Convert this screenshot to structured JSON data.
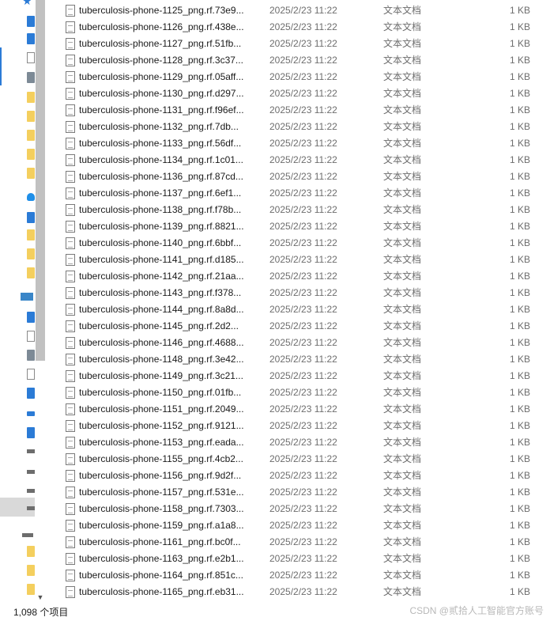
{
  "navigation": {
    "star_glyph": "★",
    "scroll_down_glyph": "▼"
  },
  "files": [
    {
      "name": "tuberculosis-phone-1125_png.rf.73e9...",
      "date": "2025/2/23 11:22",
      "type": "文本文档",
      "size": "1 KB"
    },
    {
      "name": "tuberculosis-phone-1126_png.rf.438e...",
      "date": "2025/2/23 11:22",
      "type": "文本文档",
      "size": "1 KB"
    },
    {
      "name": "tuberculosis-phone-1127_png.rf.51fb...",
      "date": "2025/2/23 11:22",
      "type": "文本文档",
      "size": "1 KB"
    },
    {
      "name": "tuberculosis-phone-1128_png.rf.3c37...",
      "date": "2025/2/23 11:22",
      "type": "文本文档",
      "size": "1 KB"
    },
    {
      "name": "tuberculosis-phone-1129_png.rf.05aff...",
      "date": "2025/2/23 11:22",
      "type": "文本文档",
      "size": "1 KB"
    },
    {
      "name": "tuberculosis-phone-1130_png.rf.d297...",
      "date": "2025/2/23 11:22",
      "type": "文本文档",
      "size": "1 KB"
    },
    {
      "name": "tuberculosis-phone-1131_png.rf.f96ef...",
      "date": "2025/2/23 11:22",
      "type": "文本文档",
      "size": "1 KB"
    },
    {
      "name": "tuberculosis-phone-1132_png.rf.7db...",
      "date": "2025/2/23 11:22",
      "type": "文本文档",
      "size": "1 KB"
    },
    {
      "name": "tuberculosis-phone-1133_png.rf.56df...",
      "date": "2025/2/23 11:22",
      "type": "文本文档",
      "size": "1 KB"
    },
    {
      "name": "tuberculosis-phone-1134_png.rf.1c01...",
      "date": "2025/2/23 11:22",
      "type": "文本文档",
      "size": "1 KB"
    },
    {
      "name": "tuberculosis-phone-1136_png.rf.87cd...",
      "date": "2025/2/23 11:22",
      "type": "文本文档",
      "size": "1 KB"
    },
    {
      "name": "tuberculosis-phone-1137_png.rf.6ef1...",
      "date": "2025/2/23 11:22",
      "type": "文本文档",
      "size": "1 KB"
    },
    {
      "name": "tuberculosis-phone-1138_png.rf.f78b...",
      "date": "2025/2/23 11:22",
      "type": "文本文档",
      "size": "1 KB"
    },
    {
      "name": "tuberculosis-phone-1139_png.rf.8821...",
      "date": "2025/2/23 11:22",
      "type": "文本文档",
      "size": "1 KB"
    },
    {
      "name": "tuberculosis-phone-1140_png.rf.6bbf...",
      "date": "2025/2/23 11:22",
      "type": "文本文档",
      "size": "1 KB"
    },
    {
      "name": "tuberculosis-phone-1141_png.rf.d185...",
      "date": "2025/2/23 11:22",
      "type": "文本文档",
      "size": "1 KB"
    },
    {
      "name": "tuberculosis-phone-1142_png.rf.21aa...",
      "date": "2025/2/23 11:22",
      "type": "文本文档",
      "size": "1 KB"
    },
    {
      "name": "tuberculosis-phone-1143_png.rf.f378...",
      "date": "2025/2/23 11:22",
      "type": "文本文档",
      "size": "1 KB"
    },
    {
      "name": "tuberculosis-phone-1144_png.rf.8a8d...",
      "date": "2025/2/23 11:22",
      "type": "文本文档",
      "size": "1 KB"
    },
    {
      "name": "tuberculosis-phone-1145_png.rf.2d2...",
      "date": "2025/2/23 11:22",
      "type": "文本文档",
      "size": "1 KB"
    },
    {
      "name": "tuberculosis-phone-1146_png.rf.4688...",
      "date": "2025/2/23 11:22",
      "type": "文本文档",
      "size": "1 KB"
    },
    {
      "name": "tuberculosis-phone-1148_png.rf.3e42...",
      "date": "2025/2/23 11:22",
      "type": "文本文档",
      "size": "1 KB"
    },
    {
      "name": "tuberculosis-phone-1149_png.rf.3c21...",
      "date": "2025/2/23 11:22",
      "type": "文本文档",
      "size": "1 KB"
    },
    {
      "name": "tuberculosis-phone-1150_png.rf.01fb...",
      "date": "2025/2/23 11:22",
      "type": "文本文档",
      "size": "1 KB"
    },
    {
      "name": "tuberculosis-phone-1151_png.rf.2049...",
      "date": "2025/2/23 11:22",
      "type": "文本文档",
      "size": "1 KB"
    },
    {
      "name": "tuberculosis-phone-1152_png.rf.9121...",
      "date": "2025/2/23 11:22",
      "type": "文本文档",
      "size": "1 KB"
    },
    {
      "name": "tuberculosis-phone-1153_png.rf.eada...",
      "date": "2025/2/23 11:22",
      "type": "文本文档",
      "size": "1 KB"
    },
    {
      "name": "tuberculosis-phone-1155_png.rf.4cb2...",
      "date": "2025/2/23 11:22",
      "type": "文本文档",
      "size": "1 KB"
    },
    {
      "name": "tuberculosis-phone-1156_png.rf.9d2f...",
      "date": "2025/2/23 11:22",
      "type": "文本文档",
      "size": "1 KB"
    },
    {
      "name": "tuberculosis-phone-1157_png.rf.531e...",
      "date": "2025/2/23 11:22",
      "type": "文本文档",
      "size": "1 KB"
    },
    {
      "name": "tuberculosis-phone-1158_png.rf.7303...",
      "date": "2025/2/23 11:22",
      "type": "文本文档",
      "size": "1 KB"
    },
    {
      "name": "tuberculosis-phone-1159_png.rf.a1a8...",
      "date": "2025/2/23 11:22",
      "type": "文本文档",
      "size": "1 KB"
    },
    {
      "name": "tuberculosis-phone-1161_png.rf.bc0f...",
      "date": "2025/2/23 11:22",
      "type": "文本文档",
      "size": "1 KB"
    },
    {
      "name": "tuberculosis-phone-1163_png.rf.e2b1...",
      "date": "2025/2/23 11:22",
      "type": "文本文档",
      "size": "1 KB"
    },
    {
      "name": "tuberculosis-phone-1164_png.rf.851c...",
      "date": "2025/2/23 11:22",
      "type": "文本文档",
      "size": "1 KB"
    },
    {
      "name": "tuberculosis-phone-1165_png.rf.eb31...",
      "date": "2025/2/23 11:22",
      "type": "文本文档",
      "size": "1 KB"
    }
  ],
  "status_bar": {
    "item_count": "1,098 个项目"
  },
  "watermark": "CSDN @贰拾人工智能官方账号",
  "colors": {
    "accent": "#2b7bd6",
    "folder": "#f4cf5e",
    "secondary_text": "#6d6d6d",
    "scroll_thumb": "#c1c1c1"
  }
}
